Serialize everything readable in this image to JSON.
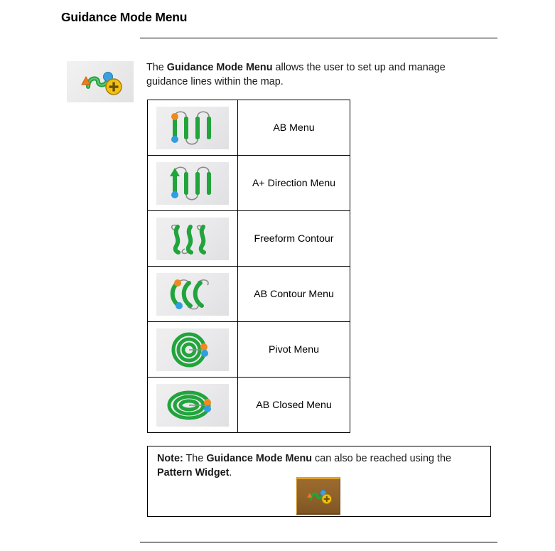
{
  "page": {
    "title": "Guidance Mode Menu",
    "intro": {
      "prefix": "The ",
      "bold": "Guidance Mode Menu",
      "suffix": " allows the user to set up and manage guidance lines within the map."
    }
  },
  "header_icon": {
    "name": "guidance-mode-menu-icon",
    "colors": {
      "path": "#22a43c",
      "triangle": "#f07a1e",
      "circle": "#3aa0e0",
      "plus_badge": "#f2c014",
      "plus_stroke": "#7a5c00",
      "tile_bg": "#ebebed"
    }
  },
  "table": {
    "rows": [
      {
        "icon": "ab-menu-icon",
        "label": "AB Menu"
      },
      {
        "icon": "a-plus-direction-icon",
        "label": "A+ Direction Menu"
      },
      {
        "icon": "freeform-contour-icon",
        "label": "Freeform Contour"
      },
      {
        "icon": "ab-contour-icon",
        "label": "AB Contour Menu"
      },
      {
        "icon": "pivot-icon",
        "label": "Pivot Menu"
      },
      {
        "icon": "ab-closed-icon",
        "label": "AB Closed Menu"
      }
    ]
  },
  "note": {
    "label": "Note:",
    "part1": " The ",
    "bold1": "Guidance Mode Menu",
    "part2": " can also be reached using the ",
    "bold2": "Pattern Widget",
    "part3": ".",
    "widget_icon": "pattern-widget-icon",
    "widget_colors": {
      "background": "#8e6029",
      "border_top": "#e0a12a"
    }
  },
  "palette": {
    "green": "#22a43c",
    "green_dark": "#16832c",
    "orange": "#f08a1e",
    "blue": "#2f9fe0",
    "gray_line": "#8a8a8a",
    "text": "#1a1a1a"
  }
}
